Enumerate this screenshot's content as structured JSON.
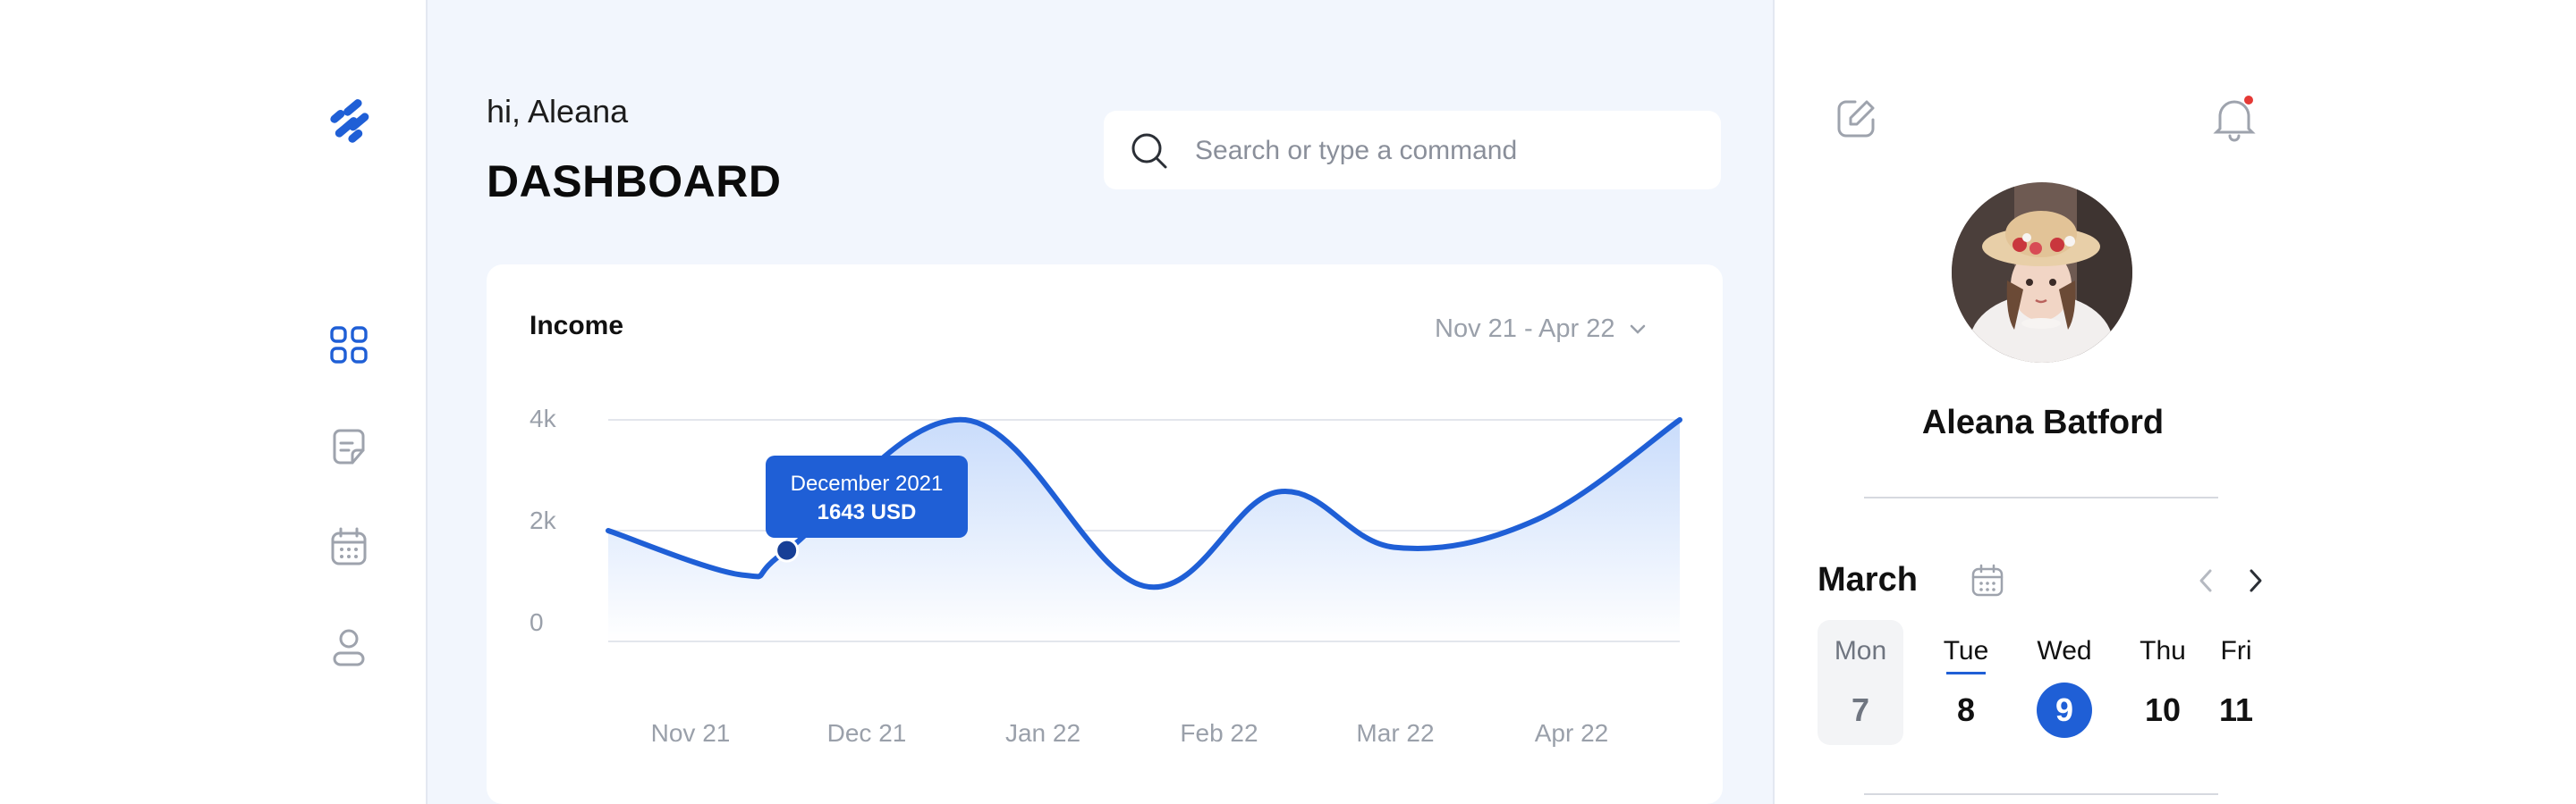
{
  "sidebar": {
    "icons": [
      "logo-icon",
      "dashboard-grid-icon",
      "document-icon",
      "calendar-icon",
      "user-icon"
    ]
  },
  "header": {
    "greeting": "hi, Aleana",
    "title": "DASHBOARD"
  },
  "search": {
    "placeholder": "Search or type a command"
  },
  "income_card": {
    "title": "Income",
    "range_label": "Nov 21 - Apr 22"
  },
  "tooltip": {
    "title": "December 2021",
    "value": "1643 USD"
  },
  "chart_data": {
    "type": "area",
    "title": "Income",
    "xlabel": "",
    "ylabel": "",
    "y_tick_labels": [
      "4k",
      "2k",
      "0"
    ],
    "x_tick_labels": [
      "Nov 21",
      "Dec 21",
      "Jan 22",
      "Feb 22",
      "Mar 22",
      "Apr 22"
    ],
    "ylim": [
      -2000,
      4000
    ],
    "grid": true,
    "series": [
      {
        "x": [
          "Nov 21",
          "Dec 21",
          "Dec 21",
          "Jan 22",
          "Feb 22",
          "Mar 22",
          "Mar 22",
          "Apr 22",
          "Apr 22"
        ],
        "x_pos": [
          0,
          0.75,
          1.0,
          2.0,
          3.0,
          3.75,
          4.4,
          5.2,
          6.0
        ],
        "values": [
          2000,
          1200,
          1643,
          4000,
          1000,
          2700,
          1700,
          2200,
          4000
        ]
      }
    ],
    "highlight": {
      "x_pos": 1.0,
      "value": 1643,
      "label": "December 2021",
      "value_label": "1643 USD"
    },
    "colors": {
      "line": "#1f5fd6",
      "fill_top": "#c9dcfb",
      "fill_bottom": "#ffffff",
      "grid": "#e3e6ec"
    }
  },
  "profile": {
    "name": "Aleana Batford",
    "notification_dot_color": "#e53935"
  },
  "calendar": {
    "month": "March",
    "days": [
      {
        "name": "Mon",
        "date": "7"
      },
      {
        "name": "Tue",
        "date": "8"
      },
      {
        "name": "Wed",
        "date": "9"
      },
      {
        "name": "Thu",
        "date": "10"
      },
      {
        "name": "Fri",
        "date": "11"
      }
    ],
    "selected_date": "9",
    "accent": "#1f5fd6"
  }
}
